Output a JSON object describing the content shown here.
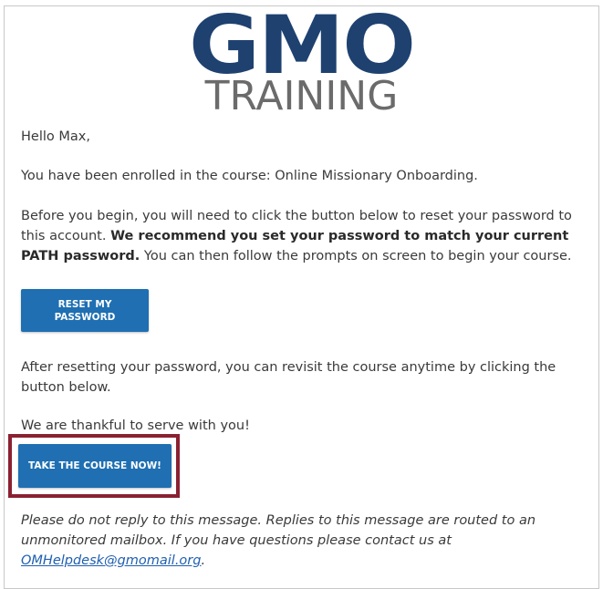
{
  "logo": {
    "line1": "GMO",
    "line2": "TRAINING",
    "primary_color": "#1e4170",
    "secondary_color": "#6b6b6b"
  },
  "email": {
    "greeting": "Hello Max,",
    "enrolled_text": "You have been enrolled in the course: Online Missionary Onboarding.",
    "before_text_1": "Before you begin, you will need to click the button below to reset your password to this account. ",
    "before_bold": "We recommend you set your password to match your current PATH password.",
    "before_text_2": " You can then follow the prompts on screen to begin your course.",
    "reset_button_label": "RESET MY PASSWORD",
    "after_text": "After resetting your password, you can revisit the course anytime by clicking the button below.",
    "thanks_text": "We are thankful to serve with you!",
    "course_button_label": "TAKE THE COURSE NOW!",
    "footer_text_1": "Please do not reply to this message. Replies to this message are routed to an unmonitored mailbox. If you have questions please contact us at ",
    "footer_email": "OMHelpdesk@gmomail.org",
    "footer_text_2": "."
  },
  "colors": {
    "button_blue": "#1f6fb2",
    "highlight_border": "#8a2131",
    "link": "#1f5fb0"
  }
}
